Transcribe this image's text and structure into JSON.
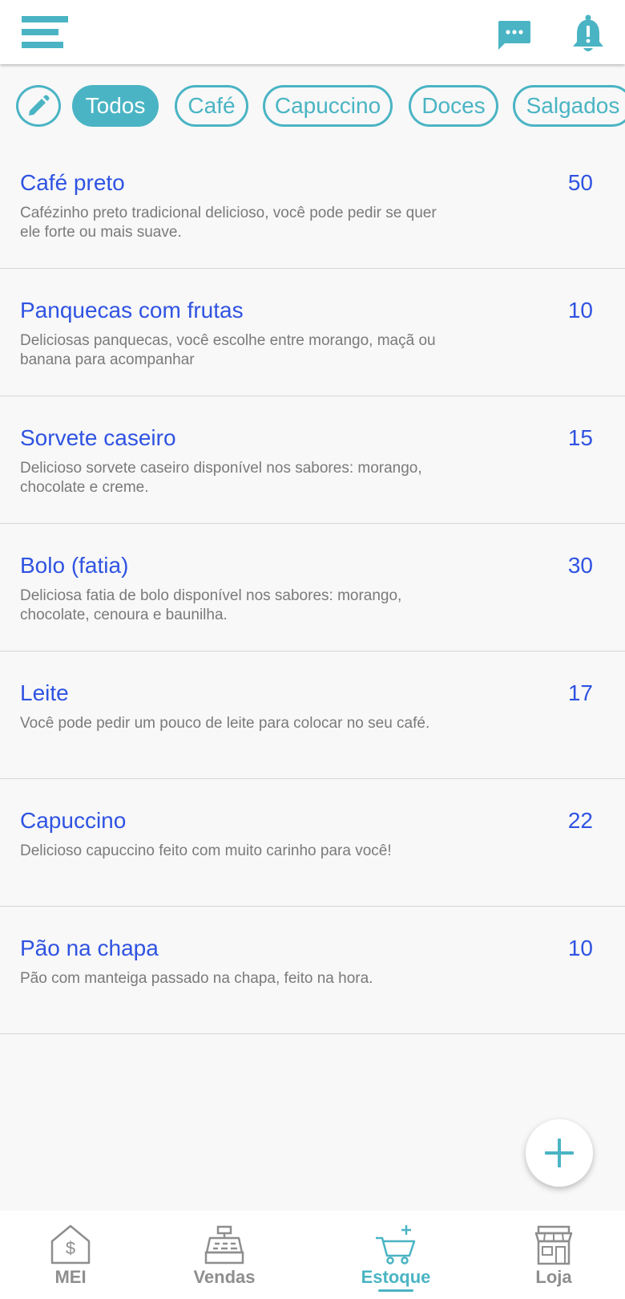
{
  "colors": {
    "accent": "#4ab4c4",
    "item_name": "#2f53e2",
    "description": "#7a7a7a",
    "nav_inactive": "#8e8e8e"
  },
  "header": {
    "icons": [
      "menu-icon",
      "chat-icon",
      "bell-alert-icon"
    ]
  },
  "filters": {
    "edit_icon": "pencil-icon",
    "chips": [
      {
        "label": "Todos",
        "active": true
      },
      {
        "label": "Café",
        "active": false
      },
      {
        "label": "Capuccino",
        "active": false
      },
      {
        "label": "Doces",
        "active": false
      },
      {
        "label": "Salgados",
        "active": false
      }
    ]
  },
  "products": [
    {
      "name": "Café preto",
      "qty": "50",
      "desc": "Cafézinho preto tradicional delicioso, você pode pedir se quer ele forte ou mais suave."
    },
    {
      "name": "Panquecas com frutas",
      "qty": "10",
      "desc": "Deliciosas panquecas, você escolhe entre morango, maçã ou banana para acompanhar"
    },
    {
      "name": "Sorvete caseiro",
      "qty": "15",
      "desc": "Delicioso sorvete caseiro disponível nos sabores: morango, chocolate e creme."
    },
    {
      "name": "Bolo (fatia)",
      "qty": "30",
      "desc": "Deliciosa fatia de bolo disponível nos sabores: morango, chocolate, cenoura e baunilha."
    },
    {
      "name": "Leite",
      "qty": "17",
      "desc": "Você pode pedir um pouco de leite para colocar no seu café."
    },
    {
      "name": "Capuccino",
      "qty": "22",
      "desc": "Delicioso capuccino feito com muito carinho para você!"
    },
    {
      "name": "Pão na chapa",
      "qty": "10",
      "desc": "Pão com manteiga passado na chapa, feito na hora."
    }
  ],
  "fab": {
    "icon": "plus-icon"
  },
  "nav": {
    "items": [
      {
        "label": "MEI",
        "icon": "house-dollar-icon",
        "active": false
      },
      {
        "label": "Vendas",
        "icon": "cash-register-icon",
        "active": false
      },
      {
        "label": "Estoque",
        "icon": "cart-plus-icon",
        "active": true
      },
      {
        "label": "Loja",
        "icon": "storefront-icon",
        "active": false
      }
    ]
  }
}
